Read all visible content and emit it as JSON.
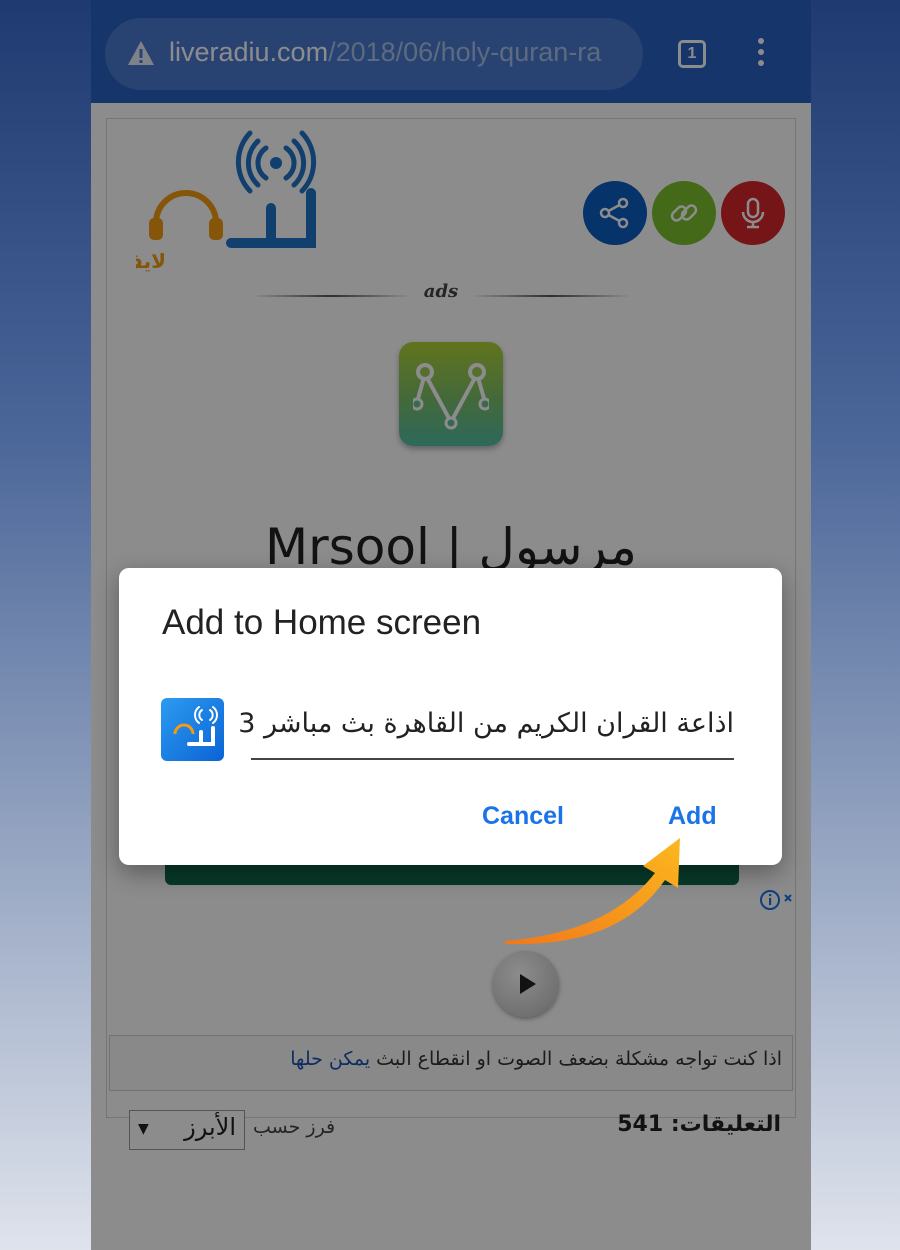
{
  "browser": {
    "url_host": "liveradiu.com",
    "url_path": "/2018/06/holy-quran-ra",
    "tab_count": "1",
    "security_icon": "warning-triangle-icon",
    "menu_icon": "vertical-dots-icon"
  },
  "page": {
    "logo_text": "راديو",
    "logo_subtext": "لايف.",
    "social_buttons": [
      "share-icon",
      "link-icon",
      "microphone-icon"
    ],
    "ad": {
      "label": "ads",
      "title": "Mrsool | مرسول"
    },
    "notice": {
      "text": "اذا كنت تواجه مشكلة بضعف الصوت او انقطاع البث ",
      "link": "يمكن حلها"
    },
    "comments": {
      "label": "التعليقات:",
      "count": "541",
      "sort_label": "فرز حسب",
      "sort_value": "الأبرز"
    }
  },
  "dialog": {
    "title": "Add to Home screen",
    "app_name": "اذاعة القران الكريم من القاهرة بث مباشر 3",
    "app_icon_text": "راديو",
    "cancel_label": "Cancel",
    "add_label": "Add"
  },
  "colors": {
    "browser_bar": "#2962c2",
    "share_button": "#0d5dc3",
    "link_button": "#7cc02d",
    "mic_button": "#d7272d",
    "dialog_button_text": "#1a73e8",
    "annotation_arrow": "#f7a21b"
  }
}
